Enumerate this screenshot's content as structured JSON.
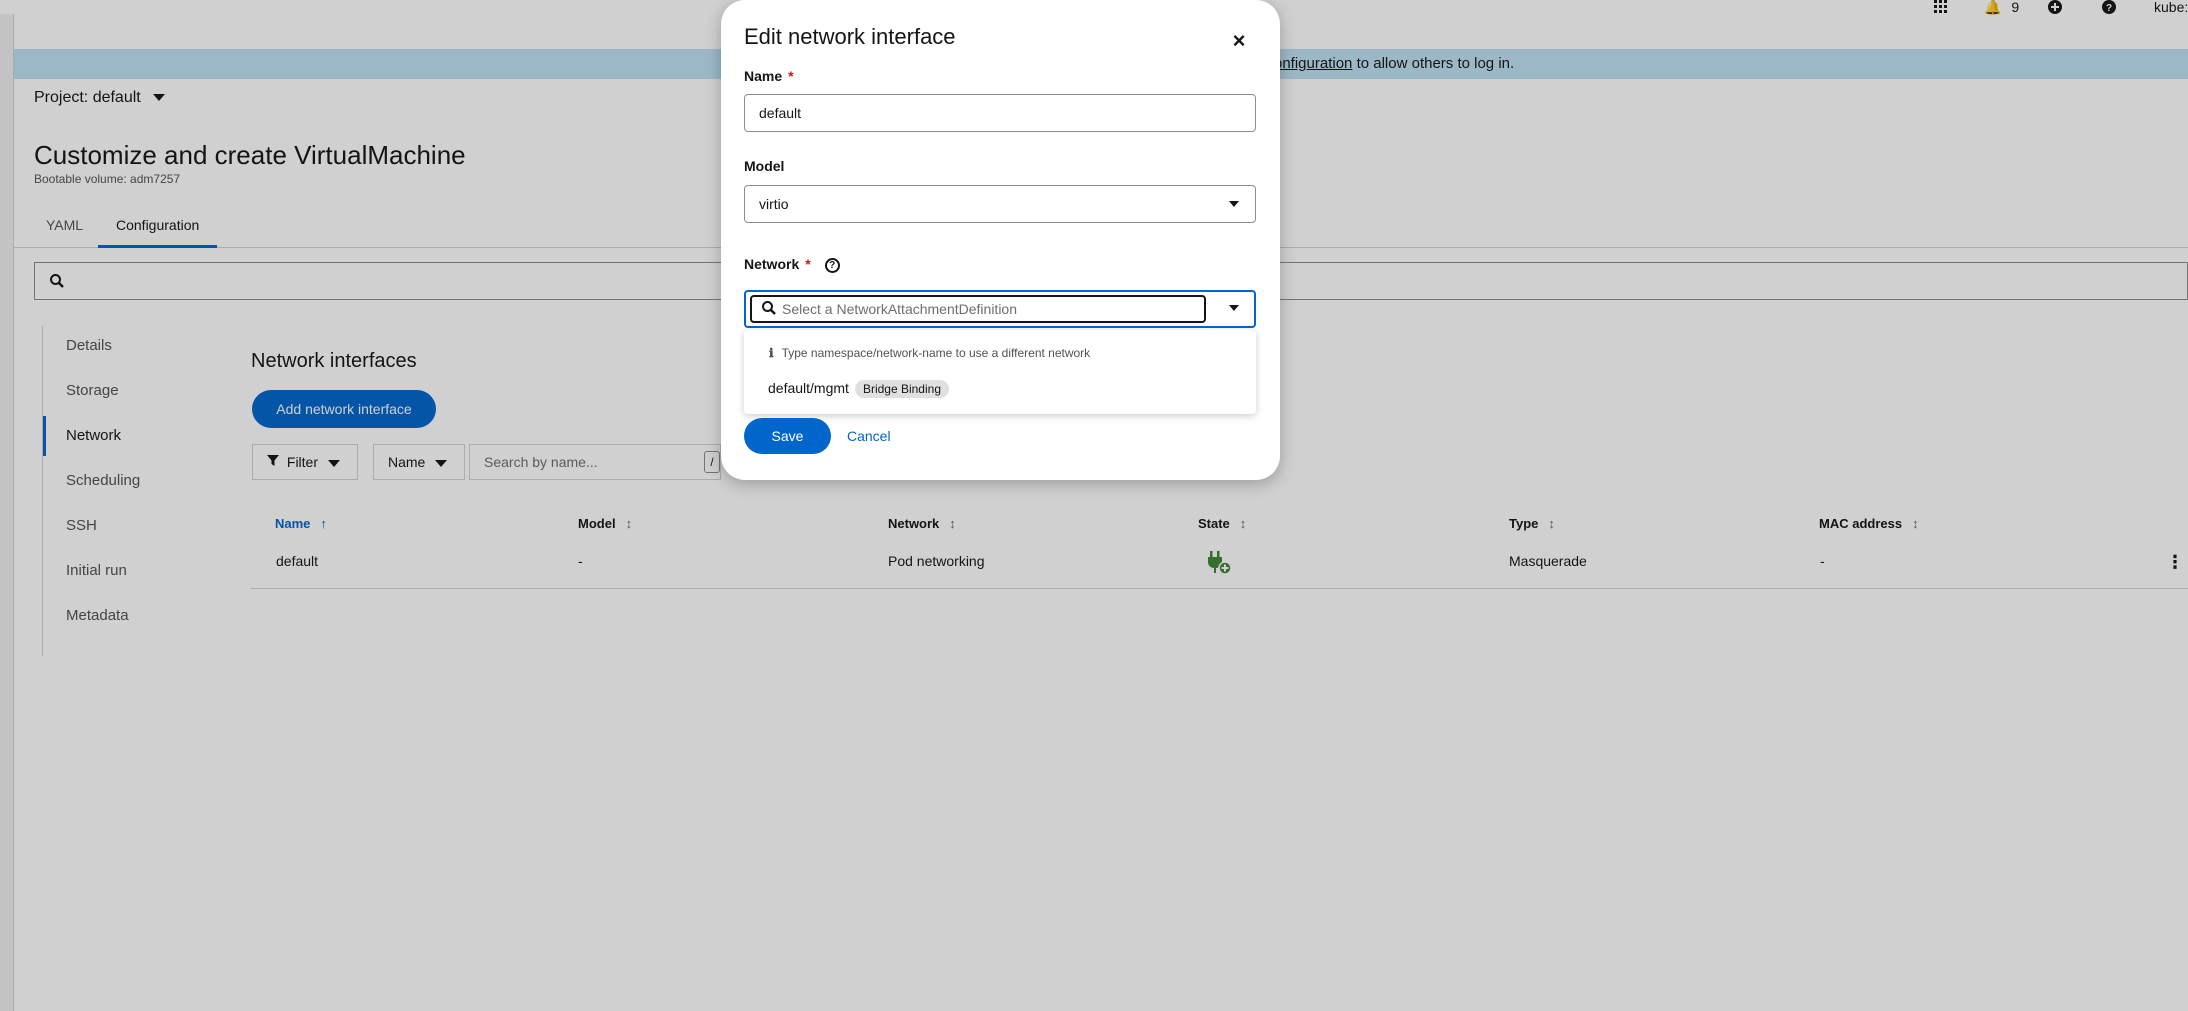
{
  "topbar": {
    "notifications_count": "9",
    "user": "kube:"
  },
  "banner": {
    "link_text": "onfiguration",
    "text": " to allow others to log in."
  },
  "project": {
    "label": "Project: default"
  },
  "page": {
    "title": "Customize and create VirtualMachine",
    "subtitle": "Bootable volume: adm7257"
  },
  "tabs": [
    {
      "label": "YAML",
      "active": false
    },
    {
      "label": "Configuration",
      "active": true
    }
  ],
  "sidenav": {
    "items": [
      {
        "label": "Details"
      },
      {
        "label": "Storage"
      },
      {
        "label": "Network",
        "active": true
      },
      {
        "label": "Scheduling"
      },
      {
        "label": "SSH"
      },
      {
        "label": "Initial run"
      },
      {
        "label": "Metadata"
      }
    ]
  },
  "network_section": {
    "title": "Network interfaces",
    "add_button": "Add network interface",
    "filter_label": "Filter",
    "name_filter_label": "Name",
    "search_placeholder": "Search by name...",
    "search_shortcut": "/"
  },
  "table": {
    "columns": [
      "Name",
      "Model",
      "Network",
      "State",
      "Type",
      "MAC address"
    ],
    "rows": [
      {
        "name": "default",
        "model": "-",
        "network": "Pod networking",
        "state": "plug-connected-icon",
        "type": "Masquerade",
        "mac": "-"
      }
    ]
  },
  "modal": {
    "title": "Edit network interface",
    "name_label": "Name",
    "name_value": "default",
    "model_label": "Model",
    "model_value": "virtio",
    "network_label": "Network",
    "network_placeholder": "Select a NetworkAttachmentDefinition",
    "dropdown_hint": "Type namespace/network-name to use a different network",
    "options": [
      {
        "label": "default/mgmt",
        "badge": "Bridge Binding"
      }
    ],
    "save_label": "Save",
    "cancel_label": "Cancel"
  },
  "colors": {
    "primary": "#0066cc",
    "banner": "#bee1f4",
    "required": "#c9190b",
    "state_icon": "#3e8635"
  }
}
